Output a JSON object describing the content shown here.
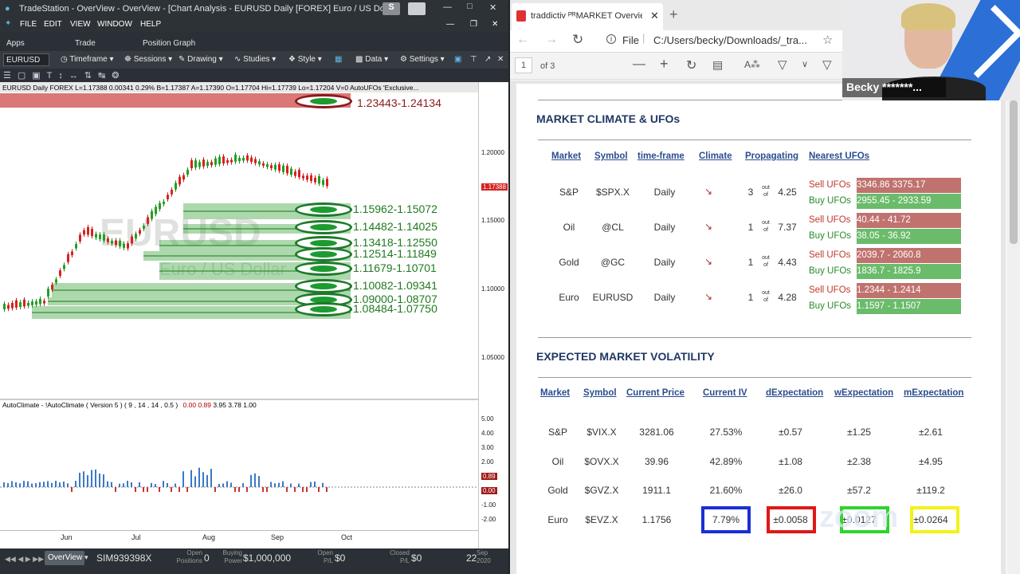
{
  "tradestation": {
    "title": "TradeStation - OverView - OverView - [Chart Analysis - EURUSD Daily [FOREX] Euro / US Dollar]",
    "badge_s": "S",
    "menu": [
      "FILE",
      "EDIT",
      "VIEW",
      "WINDOW",
      "HELP"
    ],
    "apps_row": [
      "Apps",
      "Trade",
      "Position Graph"
    ],
    "symbol": "EURUSD",
    "toolbar": [
      "Timeframe",
      "Sessions",
      "Drawing",
      "Studies",
      "Style",
      "Data",
      "Settings"
    ],
    "chart_header": "EURUSD  Daily  FOREX  L=1.17388  0.00341  0.29%  B=1.17387  A=1.17390  O=1.17704  Hi=1.17739  Lo=1.17204  V=0  AutoUFOs 'Exclusive...",
    "watermark": "EURUSD",
    "watermark_sub": "Euro / US Dollar",
    "top_zone": "1.23443-1.24134",
    "zones": [
      "1.15962-1.15072",
      "1.14482-1.14025",
      "1.13418-1.12550",
      "1.12514-1.11849",
      "1.11679-1.10701",
      "1.10082-1.09341",
      "1.09000-1.08707",
      "1.08484-1.07750"
    ],
    "price_axis": [
      "1.20000",
      "1.15000",
      "1.10000",
      "1.05000"
    ],
    "last_price": "1.17388",
    "indicator_header": "AutoClimate - !AutoClimate ( Version 5 ) ( 9 , 14 , 14 , 0.5 )",
    "indicator_values": [
      "0.00",
      "0.89",
      "3.95",
      "3.78",
      "1.00"
    ],
    "ind_axis": [
      "5.00",
      "4.00",
      "3.00",
      "2.00",
      "1.00",
      "-1.00",
      "-2.00"
    ],
    "ind_badges": [
      "0.89",
      "0.00"
    ],
    "months": [
      "Jun",
      "Jul",
      "Aug",
      "Sep",
      "Oct"
    ],
    "status": {
      "tab": "OverView",
      "account": "SIM939398X",
      "open_positions_label": "Open Positions",
      "open_positions": "0",
      "buying_power_label": "Buying Power",
      "buying_power": "$1,000,000",
      "open_pl_label": "Open P/L",
      "open_pl": "$0",
      "closed_pl_label": "Closed P/L",
      "closed_pl": "$0",
      "date_day": "22",
      "date_rest": "Sep 2020"
    }
  },
  "browser": {
    "tab_title": "traddictiv ᴾᴿMARKET Overview",
    "url": "C:/Users/becky/Downloads/_tra...",
    "file_label": "File",
    "page_num": "1",
    "page_of": "of 3"
  },
  "climate": {
    "heading": "MARKET CLIMATE & UFOs",
    "headers": [
      "Market",
      "Symbol",
      "time-frame",
      "Climate",
      "Propagating",
      "Nearest UFOs"
    ],
    "rows": [
      {
        "market": "S&P",
        "symbol": "$SPX.X",
        "tf": "Daily",
        "arrow": "↘",
        "prop": "3",
        "ratio": "4.25",
        "sell_label": "Sell UFOs",
        "sell": "3346.86    3375.17",
        "buy_label": "Buy UFOs",
        "buy": "2955.45 - 2933.59"
      },
      {
        "market": "Oil",
        "symbol": "@CL",
        "tf": "Daily",
        "arrow": "↘",
        "prop": "1",
        "ratio": "7.37",
        "sell_label": "Sell UFOs",
        "sell": "40.44 - 41.72",
        "buy_label": "Buy UFOs",
        "buy": "38.05 - 36.92"
      },
      {
        "market": "Gold",
        "symbol": "@GC",
        "tf": "Daily",
        "arrow": "↘",
        "prop": "1",
        "ratio": "4.43",
        "sell_label": "Sell UFOs",
        "sell": "2039.7 - 2060.8",
        "buy_label": "Buy UFOs",
        "buy": "1836.7 - 1825.9"
      },
      {
        "market": "Euro",
        "symbol": "EURUSD",
        "tf": "Daily",
        "arrow": "↘",
        "prop": "1",
        "ratio": "4.28",
        "sell_label": "Sell UFOs",
        "sell": "1.2344 - 1.2414",
        "buy_label": "Buy UFOs",
        "buy": "1.1597 - 1.1507"
      }
    ],
    "out_of": "out of"
  },
  "volatility": {
    "heading": "EXPECTED MARKET VOLATILITY",
    "headers": [
      "Market",
      "Symbol",
      "Current Price",
      "Current IV",
      "dExpectation",
      "wExpectation",
      "mExpectation"
    ],
    "rows": [
      {
        "market": "S&P",
        "symbol": "$VIX.X",
        "price": "3281.06",
        "iv": "27.53%",
        "d": "±0.57",
        "w": "±1.25",
        "m": "±2.61"
      },
      {
        "market": "Oil",
        "symbol": "$OVX.X",
        "price": "39.96",
        "iv": "42.89%",
        "d": "±1.08",
        "w": "±2.38",
        "m": "±4.95"
      },
      {
        "market": "Gold",
        "symbol": "$GVZ.X",
        "price": "1911.1",
        "iv": "21.60%",
        "d": "±26.0",
        "w": "±57.2",
        "m": "±119.2"
      },
      {
        "market": "Euro",
        "symbol": "$EVZ.X",
        "price": "1.1756",
        "iv": "7.79%",
        "d": "±0.0058",
        "w": "±0.0127",
        "m": "±0.0264"
      }
    ],
    "highlight_colors": {
      "iv": "#1a2fd6",
      "d": "#e01818",
      "w": "#2ed42e",
      "m": "#f2f21a"
    }
  },
  "webcam": {
    "name": "Becky *******...",
    "logo": "zoom"
  }
}
